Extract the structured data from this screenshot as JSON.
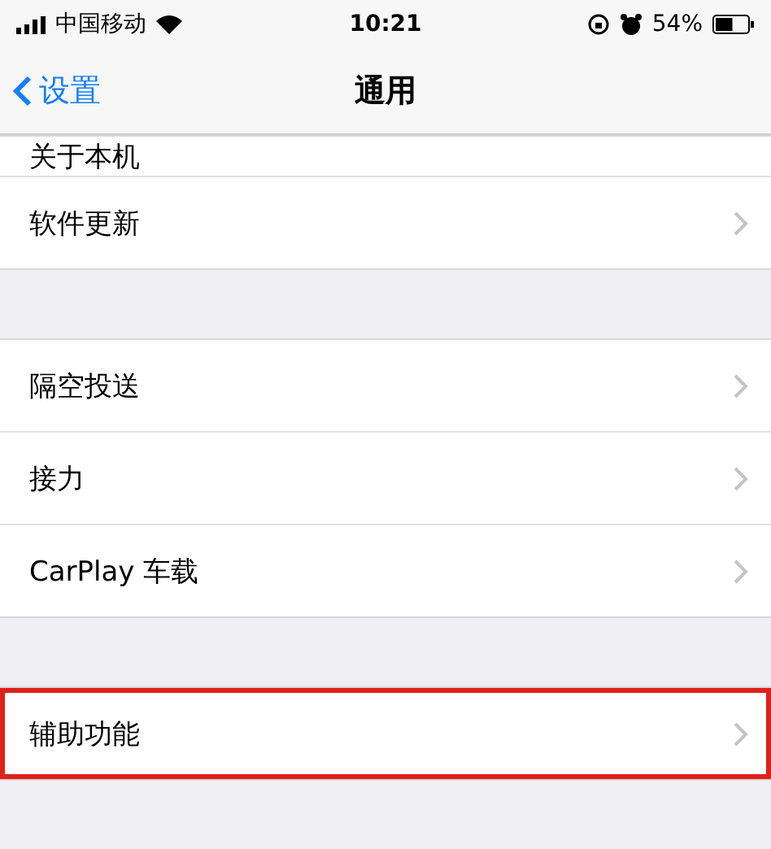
{
  "status_bar": {
    "carrier": "中国移动",
    "time": "10:21",
    "battery_text": "54%",
    "battery": {
      "level": 0.54
    }
  },
  "nav_bar": {
    "back": "设置",
    "title": "通用"
  },
  "groups": [
    {
      "rows": [
        {
          "label": "关于本机",
          "highlighted": false
        },
        {
          "label": "软件更新",
          "highlighted": false
        }
      ]
    },
    {
      "rows": [
        {
          "label": "隔空投送",
          "highlighted": false
        },
        {
          "label": "接力",
          "highlighted": false
        },
        {
          "label": "CarPlay 车载",
          "highlighted": false
        }
      ]
    },
    {
      "rows": [
        {
          "label": "辅助功能",
          "highlighted": true
        }
      ]
    }
  ]
}
